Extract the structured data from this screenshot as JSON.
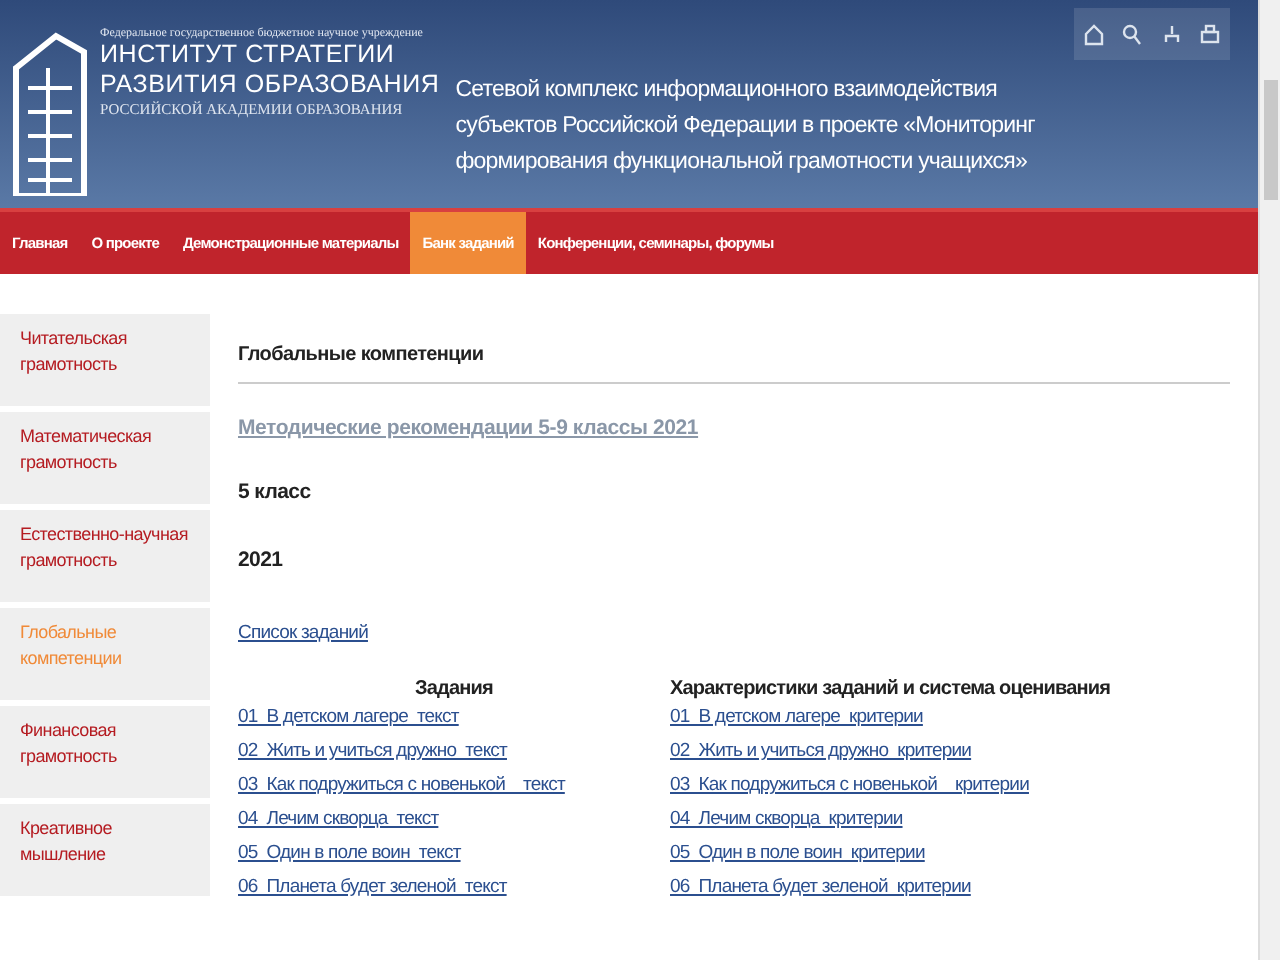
{
  "header": {
    "org_caption": "Федеральное государственное бюджетное научное учреждение",
    "logo_line_1": "ИНСТИТУТ СТРАТЕГИИ",
    "logo_line_2": "РАЗВИТИЯ ОБРАЗОВАНИЯ",
    "logo_line_3": "РОССИЙСКОЙ АКАДЕМИИ ОБРАЗОВАНИЯ",
    "project_title": "Сетевой комплекс информационного взаимодействия субъектов Российской Федерации в проекте «Мониторинг формирования функциональной грамотности учащихся»",
    "tools": [
      {
        "kind": "home"
      },
      {
        "kind": "search"
      },
      {
        "kind": "sitemap"
      },
      {
        "kind": "print"
      }
    ]
  },
  "nav": [
    {
      "label": "Главная",
      "selected": false
    },
    {
      "label": "О проекте",
      "selected": false
    },
    {
      "label": "Демонстрационные материалы",
      "selected": false
    },
    {
      "label": "Банк заданий",
      "selected": true
    },
    {
      "label": "Конференции, семинары, форумы",
      "selected": false
    }
  ],
  "sidebar": [
    {
      "label": "Читательская грамотность",
      "selected": false
    },
    {
      "label": "Математическая грамотность",
      "selected": false
    },
    {
      "label": "Естественно-научная грамотность",
      "selected": false
    },
    {
      "label": "Глобальные компетенции",
      "selected": true
    },
    {
      "label": "Финансовая грамотность",
      "selected": false
    },
    {
      "label": "Креативное мышление",
      "selected": false
    }
  ],
  "content": {
    "title": "Глобальные компетенции",
    "recommendations_link": "Методические рекомендации 5-9 классы 2021",
    "grade": "5 класс",
    "year": "2021",
    "task_list_link": "Список заданий",
    "tasks_heading": "Задания",
    "criteria_heading": "Характеристики заданий и система оценивания",
    "tasks": [
      "01  В детском лагере  текст",
      "02  Жить и учиться дружно  текст",
      "03  Как подружиться с новенькой    текст",
      "04  Лечим скворца  текст",
      "05  Один в поле воин  текст",
      "06  Планета будет зеленой  текст"
    ],
    "criteria": [
      "01  В детском лагере  критерии",
      "02  Жить и учиться дружно  критерии",
      "03  Как подружиться с новенькой    критерии",
      "04  Лечим скворца  критерии",
      "05  Один в поле воин  критерии",
      "06  Планета будет зеленой  критерии"
    ]
  }
}
